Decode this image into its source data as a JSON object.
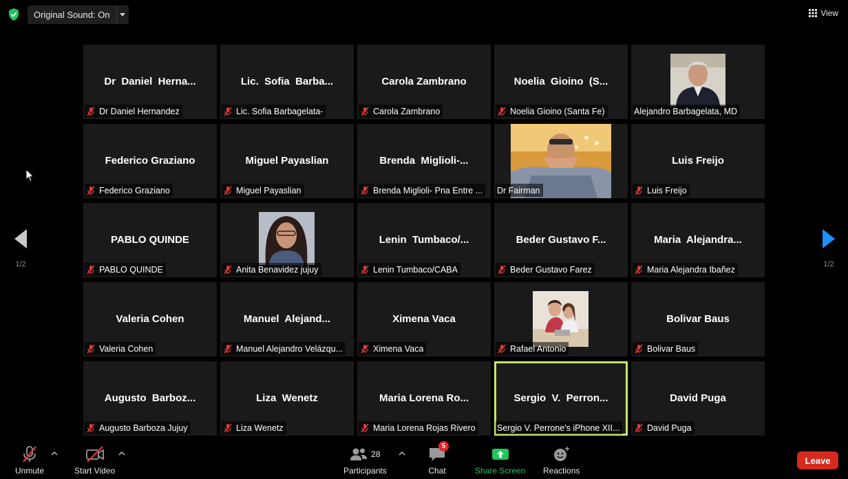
{
  "top": {
    "original_sound_label": "Original Sound: On",
    "view_label": "View"
  },
  "pagination": {
    "left_page": "1/2",
    "right_page": "1/2"
  },
  "tiles": [
    {
      "big": "Dr  Daniel  Herna...",
      "label": "Dr Daniel Hernandez",
      "muted": true,
      "photo": false
    },
    {
      "big": "Lic.  Sofia  Barba...",
      "label": "Lic. Sofia Barbagelata-",
      "muted": true,
      "photo": false
    },
    {
      "big": "Carola Zambrano",
      "label": "Carola Zambrano",
      "muted": true,
      "photo": false
    },
    {
      "big": "Noelia  Gioino  (S...",
      "label": "Noelia Gioino (Santa Fe)",
      "muted": true,
      "photo": false
    },
    {
      "big": "",
      "label": "Alejandro Barbagelata, MD",
      "muted": false,
      "photo": true
    },
    {
      "big": "Federico Graziano",
      "label": "Federico Graziano",
      "muted": true,
      "photo": false
    },
    {
      "big": "Miguel Payaslian",
      "label": "Miguel Payaslian",
      "muted": true,
      "photo": false
    },
    {
      "big": "Brenda  Miglioli-...",
      "label": "Brenda Miglioli- Pna Entre ...",
      "muted": true,
      "photo": false
    },
    {
      "big": "",
      "label": "Dr Fairman",
      "muted": false,
      "photo": true
    },
    {
      "big": "Luis Freijo",
      "label": "Luis Freijo",
      "muted": true,
      "photo": false
    },
    {
      "big": "PABLO QUINDE",
      "label": "PABLO QUINDE",
      "muted": true,
      "photo": false
    },
    {
      "big": "",
      "label": "Anita Benavidez jujuy",
      "muted": true,
      "photo": true
    },
    {
      "big": "Lenin  Tumbaco/...",
      "label": "Lenin Tumbaco/CABA",
      "muted": true,
      "photo": false
    },
    {
      "big": "Beder Gustavo F...",
      "label": "Beder Gustavo Farez",
      "muted": true,
      "photo": false
    },
    {
      "big": "Maria  Alejandra...",
      "label": "Maria Alejandra Ibañez",
      "muted": true,
      "photo": false
    },
    {
      "big": "Valeria Cohen",
      "label": "Valeria Cohen",
      "muted": true,
      "photo": false
    },
    {
      "big": "Manuel  Alejand...",
      "label": "Manuel Alejandro Velázqu...",
      "muted": true,
      "photo": false
    },
    {
      "big": "Ximena Vaca",
      "label": "Ximena Vaca",
      "muted": true,
      "photo": false
    },
    {
      "big": "",
      "label": "Rafael Antonio",
      "muted": true,
      "photo": true
    },
    {
      "big": "Bolivar Baus",
      "label": "Bolivar Baus",
      "muted": true,
      "photo": false
    },
    {
      "big": "Augusto  Barboz...",
      "label": "Augusto Barboza Jujuy",
      "muted": true,
      "photo": false
    },
    {
      "big": "Liza  Wenetz",
      "label": "Liza  Wenetz",
      "muted": true,
      "photo": false
    },
    {
      "big": "Maria Lorena Ro...",
      "label": "Maria Lorena Rojas Rivero",
      "muted": true,
      "photo": false
    },
    {
      "big": "Sergio  V.  Perron...",
      "label": "Sergio V. Perrone's iPhone XII...",
      "muted": false,
      "photo": false,
      "speaking": true
    },
    {
      "big": "David Puga",
      "label": "David Puga",
      "muted": true,
      "photo": false
    }
  ],
  "toolbar": {
    "unmute_label": "Unmute",
    "start_video_label": "Start Video",
    "participants_label": "Participants",
    "participants_count": "28",
    "chat_label": "Chat",
    "chat_badge": "5",
    "share_screen_label": "Share Screen",
    "reactions_label": "Reactions",
    "leave_label": "Leave"
  },
  "colors": {
    "speaking_border": "#c7e66d",
    "share_green": "#23c45e",
    "leave_red": "#d52b1e",
    "muted_red": "#e23a3a"
  }
}
